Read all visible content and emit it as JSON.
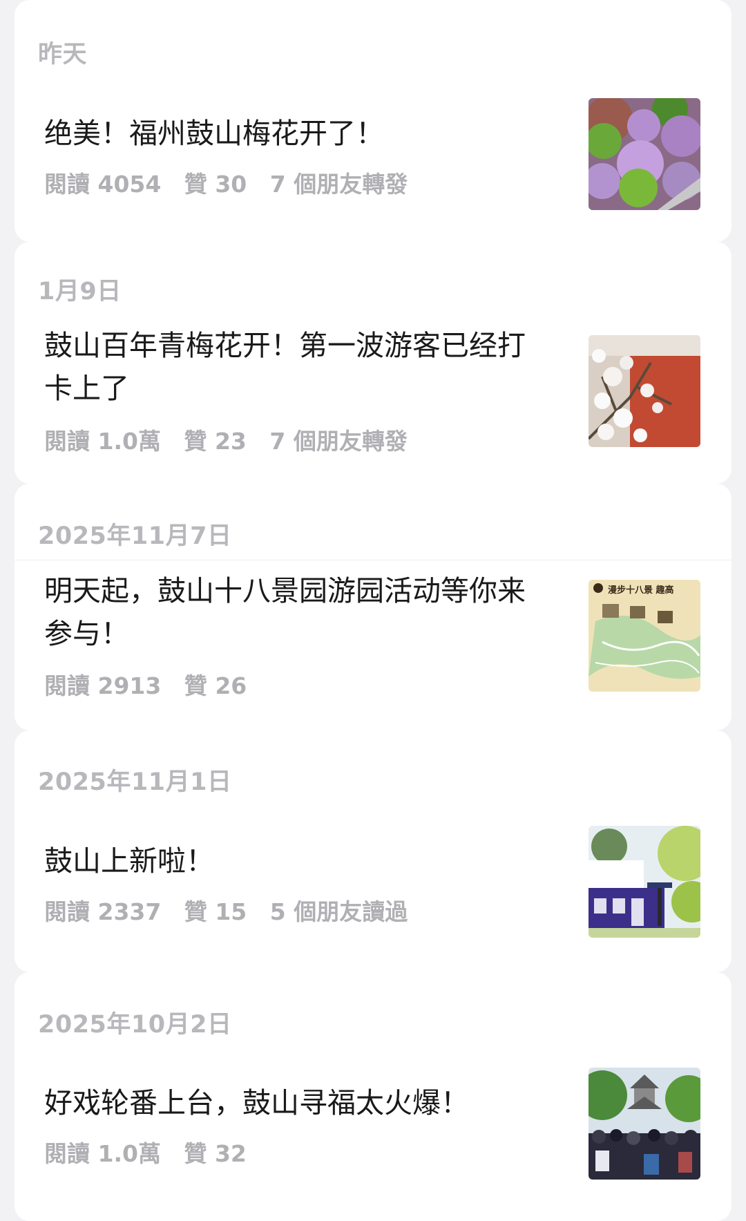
{
  "posts": [
    {
      "date": "昨天",
      "title": "绝美！福州鼓山梅花开了！",
      "reads": "閱讀 4054",
      "likes": "贊 30",
      "friends": "7 個朋友轉發",
      "thumb_icon": "plum-blossom-aerial-thumbnail"
    },
    {
      "date": "1月9日",
      "title": "鼓山百年青梅花开！第一波游客已经打卡上了",
      "reads": "閱讀 1.0萬",
      "likes": "贊 23",
      "friends": "7 個朋友轉發",
      "thumb_icon": "white-plum-blossom-thumbnail"
    },
    {
      "date": "2025年11月7日",
      "title": "明天起，鼓山十八景园游园活动等你来参与！",
      "reads": "閱讀 2913",
      "likes": "贊 26",
      "friends": "",
      "thumb_icon": "scenic-map-thumbnail"
    },
    {
      "date": "2025年11月1日",
      "title": "鼓山上新啦！",
      "reads": "閱讀 2337",
      "likes": "贊 15",
      "friends": "5 個朋友讀過",
      "thumb_icon": "building-thumbnail"
    },
    {
      "date": "2025年10月2日",
      "title": "好戏轮番上台，鼓山寻福太火爆！",
      "reads": "閱讀 1.0萬",
      "likes": "贊 32",
      "friends": "",
      "thumb_icon": "crowd-pavilion-thumbnail"
    }
  ],
  "map_thumb_text": "漫步十八景 趣高",
  "colors": {
    "background": "#f2f2f4",
    "card": "#ffffff",
    "title": "#1a1a1a",
    "meta": "#b0b0b4",
    "date": "#b8b8bc"
  }
}
